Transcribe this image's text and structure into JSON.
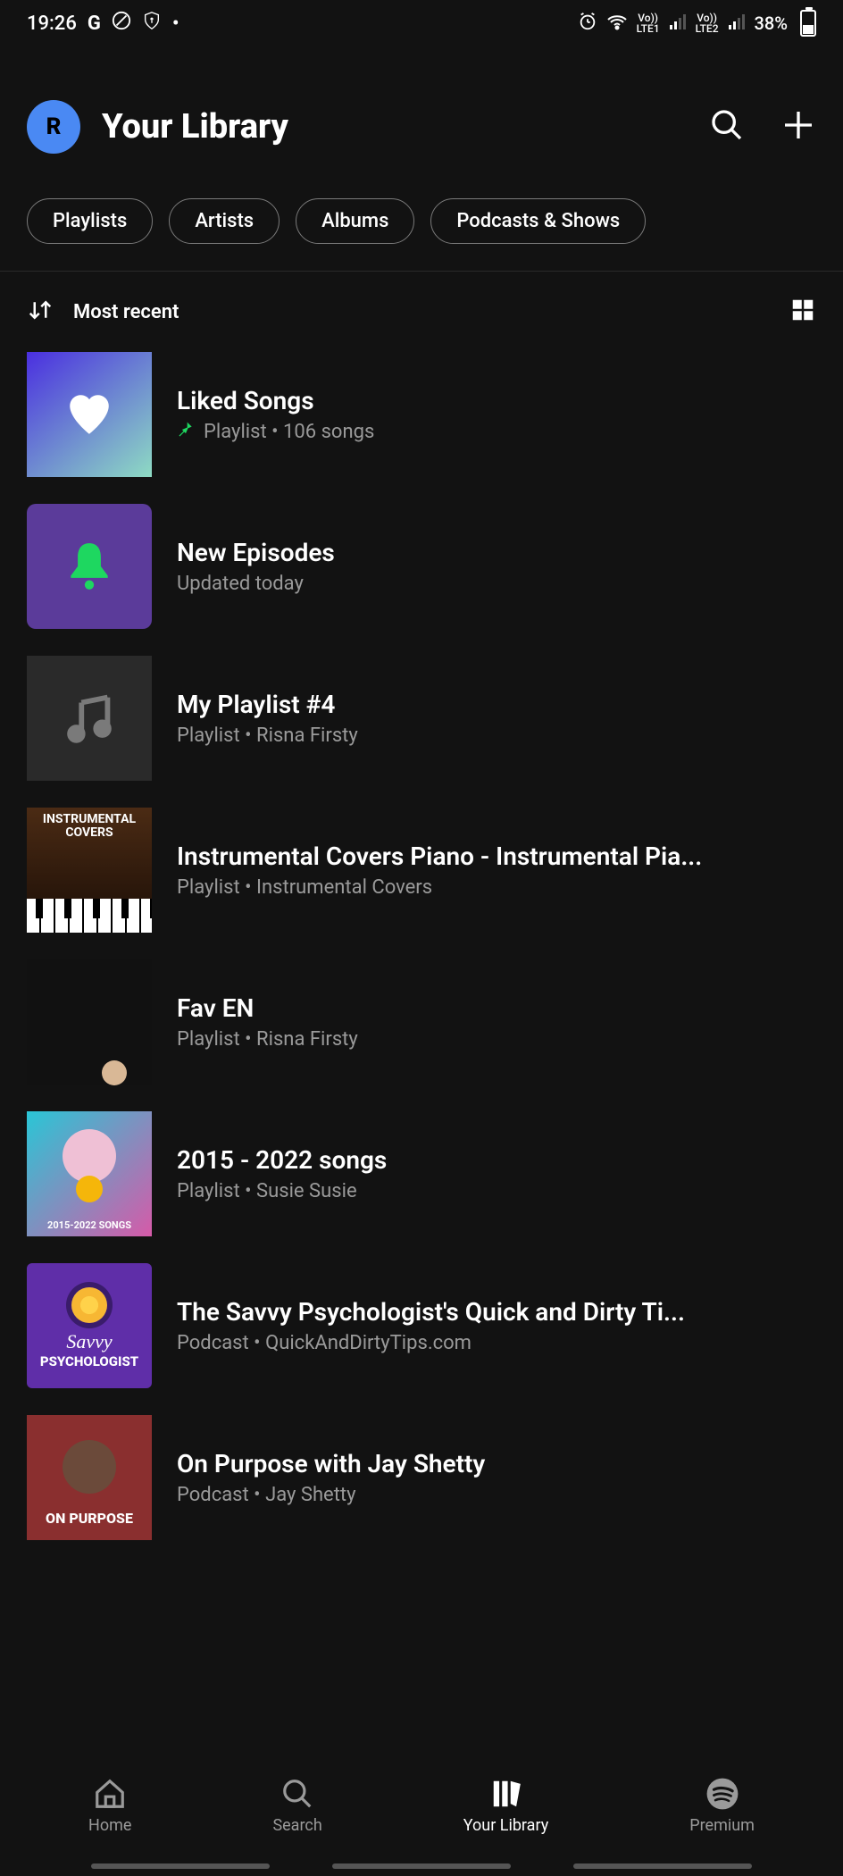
{
  "status": {
    "time": "19:26",
    "battery_pct": "38%",
    "lte1": "Vo))\nLTE1",
    "lte2": "Vo))\nLTE2"
  },
  "header": {
    "avatar_initial": "R",
    "title": "Your Library"
  },
  "filters": {
    "playlists": "Playlists",
    "artists": "Artists",
    "albums": "Albums",
    "podcasts": "Podcasts & Shows"
  },
  "sort": {
    "label": "Most recent"
  },
  "items": [
    {
      "title": "Liked Songs",
      "subtitle": "Playlist • 106 songs",
      "pinned": true
    },
    {
      "title": "New Episodes",
      "subtitle": "Updated today"
    },
    {
      "title": "My Playlist #4",
      "subtitle": "Playlist • Risna Firsty"
    },
    {
      "title": "Instrumental Covers Piano - Instrumental Pia...",
      "subtitle": "Playlist • Instrumental Covers",
      "art_label": "INSTRUMENTAL COVERS"
    },
    {
      "title": "Fav EN",
      "subtitle": "Playlist • Risna Firsty"
    },
    {
      "title": "2015 - 2022 songs",
      "subtitle": "Playlist • Susie Susie",
      "art_label": "2015-2022 SONGS"
    },
    {
      "title": "The Savvy Psychologist's Quick and Dirty Ti...",
      "subtitle": "Podcast • QuickAndDirtyTips.com",
      "art_top": "Savvy",
      "art_bottom": "PSYCHOLOGIST"
    },
    {
      "title": "On Purpose with Jay Shetty",
      "subtitle": "Podcast • Jay Shetty",
      "art_label": "ON PURPOSE"
    }
  ],
  "nav": {
    "home": "Home",
    "search": "Search",
    "library": "Your Library",
    "premium": "Premium"
  }
}
